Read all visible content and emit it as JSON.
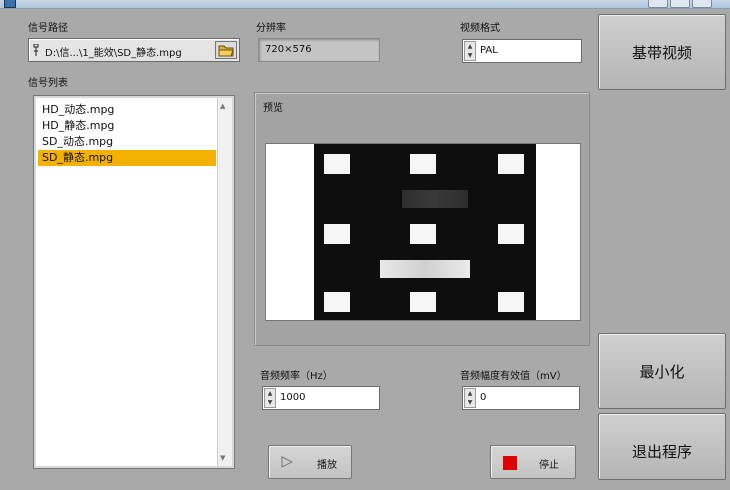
{
  "labels": {
    "signal_path": "信号路径",
    "resolution": "分辨率",
    "video_format": "视频格式",
    "signal_list": "信号列表",
    "preview": "预览",
    "audio_freq": "音频频率（Hz）",
    "audio_amp": "音频幅度有效值（mV）"
  },
  "path": {
    "value": "D:\\信...\\1_能效\\SD_静态.mpg"
  },
  "resolution_value": "720×576",
  "video_format_value": "PAL",
  "signal_list": {
    "items": [
      "HD_动态.mpg",
      "HD_静态.mpg",
      "SD_动态.mpg",
      "SD_静态.mpg"
    ],
    "selected_index": 3
  },
  "audio": {
    "freq_value": "1000",
    "amp_value": "0"
  },
  "buttons": {
    "baseband": "基带视频",
    "minimize": "最小化",
    "exit": "退出程序",
    "play": "播放",
    "stop": "停止"
  },
  "colors": {
    "selection": "#f4b100",
    "stop_icon": "#e00000",
    "background": "#a9a9a9"
  }
}
